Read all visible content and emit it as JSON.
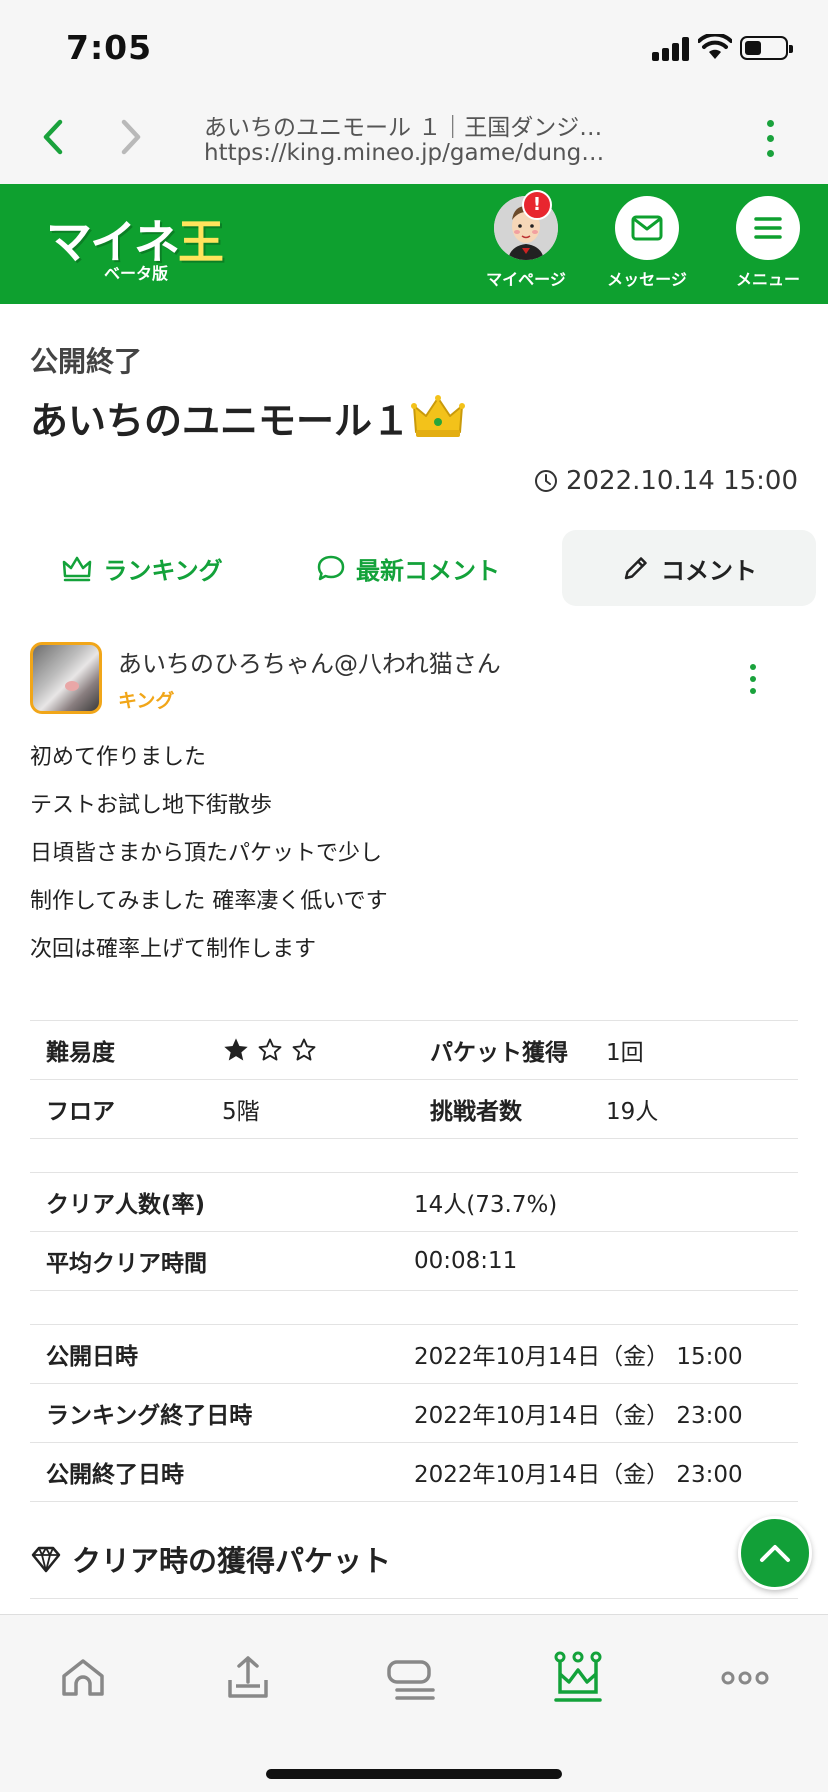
{
  "status_bar": {
    "time": "7:05"
  },
  "browser": {
    "page_title": "あいちのユニモール １｜王国ダンジ…",
    "url": "https://king.mineo.jp/game/dung…"
  },
  "header": {
    "logo_text_a": "マイネ",
    "logo_text_b": "王",
    "logo_sub": "ベータ版",
    "mypage_label": "マイページ",
    "mypage_badge": "!",
    "message_label": "メッセージ",
    "menu_label": "メニュー"
  },
  "dungeon": {
    "status": "公開終了",
    "title": "あいちのユニモール１",
    "datetime": "2022.10.14 15:00"
  },
  "tabs": {
    "ranking": "ランキング",
    "latest_comments": "最新コメント",
    "comment": "コメント"
  },
  "post": {
    "author": "あいちのひろちゃん@八われ猫さん",
    "rank": "キング",
    "lines": [
      "初めて作りました",
      "テストお試し地下街散歩",
      "日頃皆さまから頂たパケットで少し",
      "制作してみました 確率凄く低いです",
      "次回は確率上げて制作します"
    ]
  },
  "stats": {
    "difficulty_label": "難易度",
    "difficulty_stars_filled": 1,
    "difficulty_stars_total": 3,
    "packet_label": "パケット獲得",
    "packet_value": "1回",
    "floor_label": "フロア",
    "floor_value": "5階",
    "challengers_label": "挑戦者数",
    "challengers_value": "19人"
  },
  "clear": {
    "clear_count_label": "クリア人数(率)",
    "clear_count_value": "14人(73.7%)",
    "avg_time_label": "平均クリア時間",
    "avg_time_value": "00:08:11"
  },
  "dates": {
    "publish_label": "公開日時",
    "publish_value": "2022年10月14日（金） 15:00",
    "ranking_end_label": "ランキング終了日時",
    "ranking_end_value": "2022年10月14日（金） 23:00",
    "publish_end_label": "公開終了日時",
    "publish_end_value": "2022年10月14日（金） 23:00"
  },
  "section": {
    "packet_title": "クリア時の獲得パケット"
  },
  "colors": {
    "brand_green": "#0ea02f",
    "rank_gold": "#f1a619"
  }
}
